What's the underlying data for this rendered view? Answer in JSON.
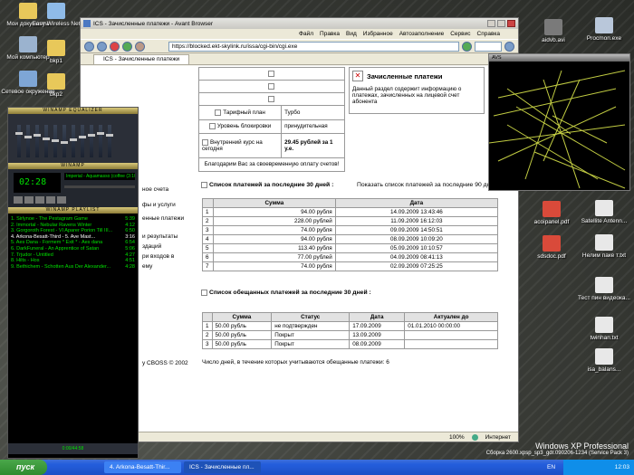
{
  "desktop": {
    "left_icons": [
      {
        "label": "Мои документы"
      },
      {
        "label": "Easy Wireless Net"
      },
      {
        "label": "Мой компьютер"
      },
      {
        "label": "bkp1"
      },
      {
        "label": "Сетевое окружение"
      },
      {
        "label": "bkp2"
      }
    ],
    "right_icons": [
      {
        "label": "aidvb.avi"
      },
      {
        "label": "Procmon.exe"
      },
      {
        "label": "acoipanel.pdf"
      },
      {
        "label": "Satellite Antenn..."
      },
      {
        "label": "sdsdoc.pdf"
      },
      {
        "label": "Нелим паке т.txt"
      },
      {
        "label": "Тест пин видеока..."
      },
      {
        "label": "twinhan.txt"
      },
      {
        "label": "isa_balans..."
      }
    ],
    "watermark": {
      "title": "Windows XP Professional",
      "subtitle": "Сборка 2600.xpsp_sp3_gdr.090206-1234 (Service Pack 3)"
    }
  },
  "browser": {
    "title": "ICS - Зачисленные платежи - Avant Browser",
    "menu": [
      "Файл",
      "Правка",
      "Вид",
      "Избранное",
      "Автозаполнение",
      "Сервис",
      "Справка"
    ],
    "address": "https://blocked.ekt-skylink.ru/issa/cgi-bin/cgi.exe",
    "tab": "ICS - Зачисленные платежи",
    "zoom": "100%",
    "status": "Интернет",
    "page": {
      "info_rows": [
        {
          "label": "Тарифный план",
          "value": "Турбо"
        },
        {
          "label": "Уровень блокировки",
          "value": "принудительная"
        },
        {
          "label": "Внутренний курс на сегодня",
          "value": "29.45 рублей за 1 у.е."
        }
      ],
      "thanks": "Благодарим Вас за своевременную оплату счетов!",
      "section_title": "Зачисленные платежи",
      "section_desc": "Данный раздел содержит информацию о платежах, зачисленных на лицевой счет абонента",
      "side_links": [
        "ное счета",
        "фы и услуги",
        "енные платежи",
        "и результаты",
        "здаций",
        "ри входов в",
        "ему"
      ],
      "copyright": "y CBOSS © 2002",
      "payments_heading": "Список платежей за последние 30 дней :",
      "payments_link": "Показать список платежей за последние 90 дней",
      "payments_cols": [
        "",
        "Сумма",
        "Дата"
      ],
      "payments": [
        [
          "1",
          "94.00 рубля",
          "14.09.2009 13:43:46"
        ],
        [
          "2",
          "228.00 рублей",
          "11.09.2009 16:12:03"
        ],
        [
          "3",
          "74.00 рубля",
          "09.09.2009 14:50:51"
        ],
        [
          "4",
          "94.00 рубля",
          "08.09.2009 10:09:20"
        ],
        [
          "5",
          "113.40 рубля",
          "05.09.2009 10:10:57"
        ],
        [
          "6",
          "77.00 рублей",
          "04.09.2009 08:41:13"
        ],
        [
          "7",
          "74.00 рубля",
          "02.09.2009 07:25:25"
        ]
      ],
      "promised_heading": "Список обещанных платежей за последние 30 дней :",
      "promised_cols": [
        "",
        "Сумма",
        "Статус",
        "Дата",
        "Актуален до"
      ],
      "promised": [
        [
          "1",
          "50.00 рубль",
          "не подтвержден",
          "17.09.2009",
          "01.01.2010 00:00:00"
        ],
        [
          "2",
          "50.00 рубль",
          "Покрыт",
          "13.09.2009",
          ""
        ],
        [
          "3",
          "50.00 рубль",
          "Покрыт",
          "08.09.2009",
          ""
        ]
      ],
      "days_note": "Число дней, в течение которых учитываются обещанные платежи: 6"
    }
  },
  "winamp": {
    "eq_title": "WINAMP EQUALIZER",
    "title": "WINAMP",
    "time": "02:28",
    "song": "Imperial - Aquamasso (coffee (3:10))",
    "playlist_title": "WINAMP PLAYLIST",
    "playlist": [
      {
        "title": "1. Sirlynoe - The Pestagram Game",
        "time": "5:39"
      },
      {
        "title": "2. Immortal - Nebular Ravens Winter",
        "time": "4:12"
      },
      {
        "title": "3. Gorgoroth Forest - VI Aparer Porion Till III...",
        "time": "6:50"
      },
      {
        "title": "4. Arkona-Besatt-Third - 5. Ave Mast...",
        "time": "3:16"
      },
      {
        "title": "5. Aes Dana - Formem * Exit * - Aes dana",
        "time": "6:54"
      },
      {
        "title": "6. DarkFuneral - An Apprentice of Satan",
        "time": "5:06"
      },
      {
        "title": "7. Trjudor - Untitled",
        "time": "4:27"
      },
      {
        "title": "8. Hilts - Hos",
        "time": "4:51"
      },
      {
        "title": "9. Bethichem - Schotten Aus Der Alexander...",
        "time": "4:28"
      }
    ],
    "footer": "0:00/44:58"
  },
  "avs": {
    "title": "AVS"
  },
  "taskbar": {
    "start": "пуск",
    "buttons": [
      {
        "label": "4. Arkona-Besatt-Thir..."
      },
      {
        "label": "ICS - Зачисленные пл..."
      }
    ],
    "lang": "EN",
    "clock": "12:03"
  }
}
